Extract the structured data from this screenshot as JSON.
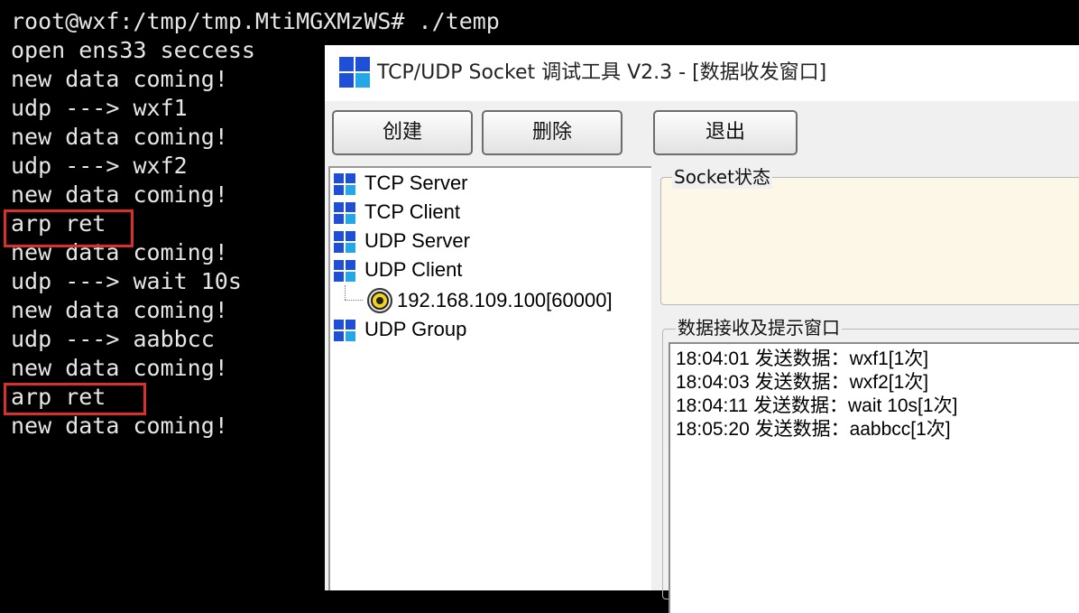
{
  "terminal": {
    "lines": [
      "root@wxf:/tmp/tmp.MtiMGXMzWS# ./temp",
      "open ens33 seccess",
      "new data coming!",
      "udp ---> wxf1",
      "new data coming!",
      "udp ---> wxf2",
      "new data coming!",
      "arp ret",
      "new data coming!",
      "udp ---> wait 10s",
      "new data coming!",
      "udp ---> aabbcc",
      "new data coming!",
      "arp ret",
      "new data coming!"
    ],
    "highlight_color": "#d9302c"
  },
  "window": {
    "title": "TCP/UDP Socket 调试工具 V2.3 - [数据收发窗口]",
    "app_icon": "grid-icon",
    "toolbar": {
      "create_label": "创建",
      "delete_label": "删除",
      "exit_label": "退出"
    },
    "tree": {
      "items": [
        {
          "label": "TCP Server",
          "icon": "grid-icon"
        },
        {
          "label": "TCP Client",
          "icon": "grid-icon"
        },
        {
          "label": "UDP Server",
          "icon": "grid-icon"
        },
        {
          "label": "UDP Client",
          "icon": "grid-icon"
        },
        {
          "label": "UDP Group",
          "icon": "grid-icon"
        }
      ],
      "child": {
        "label": "192.168.109.100[60000]",
        "icon": "target-icon"
      }
    },
    "socket_status": {
      "legend": "Socket状态"
    },
    "recv": {
      "legend": "数据接收及提示窗口",
      "lines": [
        "18:04:01 发送数据：wxf1[1次]",
        "18:04:03 发送数据：wxf2[1次]",
        "18:04:11 发送数据：wait 10s[1次]",
        "18:05:20 发送数据：aabbcc[1次]"
      ]
    }
  }
}
